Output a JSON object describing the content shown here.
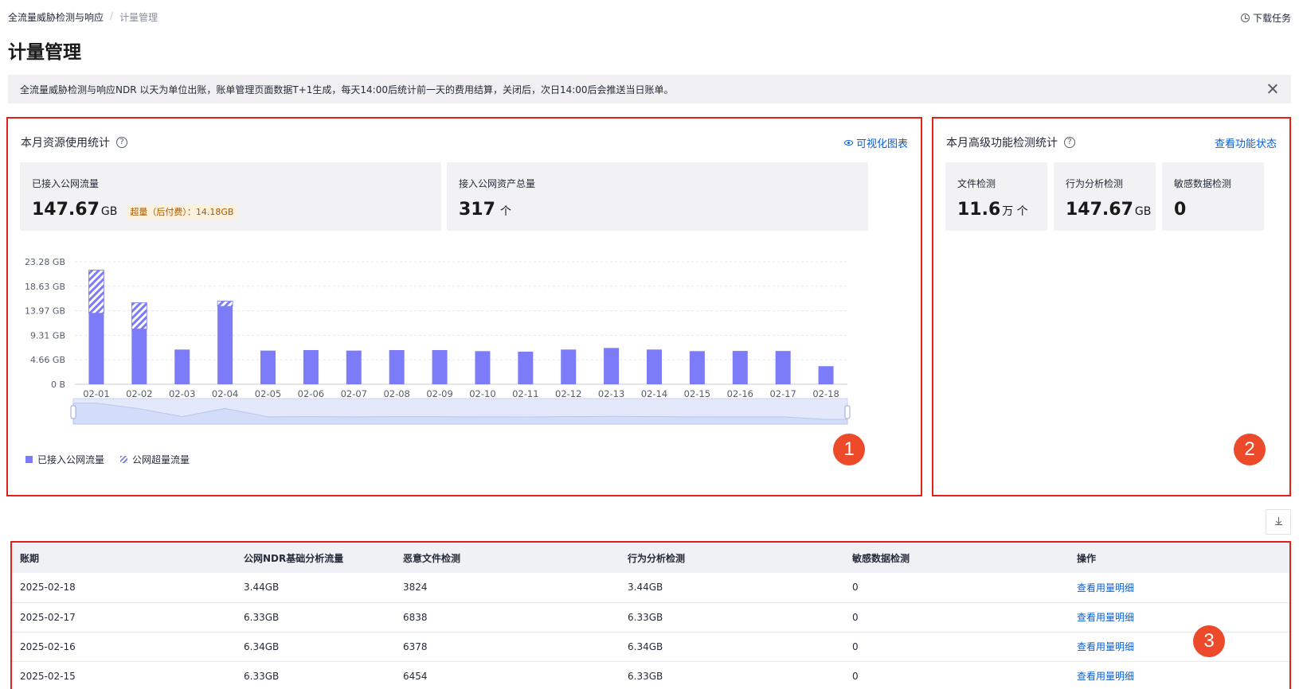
{
  "breadcrumb": {
    "parent": "全流量威胁检测与响应",
    "separator": "/",
    "current": "计量管理"
  },
  "header": {
    "download_tasks": "下载任务",
    "title": "计量管理"
  },
  "notice": {
    "text": "全流量威胁检测与响应NDR 以天为单位出账，账单管理页面数据T+1生成，每天14:00后统计前一天的费用结算，关闭后，次日14:00后会推送当日账单。"
  },
  "resource_panel": {
    "title": "本月资源使用统计",
    "visual_link": "可视化图表",
    "badge": "1",
    "cards": [
      {
        "label": "已接入公网流量",
        "value": "147.67",
        "unit": "GB",
        "overage": "超量（后付费）：14.18GB"
      },
      {
        "label": "接入公网资产总量",
        "value": "317",
        "unit": "个"
      }
    ]
  },
  "advanced_panel": {
    "title": "本月高级功能检测统计",
    "status_link": "查看功能状态",
    "badge": "2",
    "cards": [
      {
        "label": "文件检测",
        "value": "11.6",
        "unit": "万 个"
      },
      {
        "label": "行为分析检测",
        "value": "147.67",
        "unit": "GB"
      },
      {
        "label": "敏感数据检测",
        "value": "0",
        "unit": ""
      }
    ]
  },
  "chart_data": {
    "type": "bar",
    "stacked": true,
    "categories": [
      "02-01",
      "02-02",
      "02-03",
      "02-04",
      "02-05",
      "02-06",
      "02-07",
      "02-08",
      "02-09",
      "02-10",
      "02-11",
      "02-12",
      "02-13",
      "02-14",
      "02-15",
      "02-16",
      "02-17",
      "02-18"
    ],
    "series": [
      {
        "name": "已接入公网流量",
        "values": [
          13.5,
          10.5,
          6.6,
          14.8,
          6.4,
          6.5,
          6.4,
          6.5,
          6.5,
          6.3,
          6.2,
          6.6,
          6.9,
          6.6,
          6.3,
          6.34,
          6.33,
          3.44
        ]
      },
      {
        "name": "公网超量流量",
        "values": [
          8.2,
          5.0,
          0,
          1.0,
          0,
          0,
          0,
          0,
          0,
          0,
          0,
          0,
          0,
          0,
          0,
          0,
          0,
          0
        ]
      }
    ],
    "y_ticks": [
      "0 B",
      "4.66 GB",
      "9.31 GB",
      "13.97 GB",
      "18.63 GB",
      "23.28 GB"
    ],
    "ylim": [
      0,
      23.28
    ],
    "grid": "horizontal-dashed",
    "legend_position": "bottom-left",
    "colors": {
      "primary": "#7c7cf8"
    }
  },
  "table": {
    "badge": "3",
    "columns": [
      "账期",
      "公网NDR基础分析流量",
      "恶意文件检测",
      "行为分析检测",
      "敏感数据检测",
      "操作"
    ],
    "rows": [
      {
        "date": "2025-02-18",
        "ndr": "3.44GB",
        "malware": "3824",
        "behavior": "3.44GB",
        "sensitive": "0",
        "action": "查看用量明细"
      },
      {
        "date": "2025-02-17",
        "ndr": "6.33GB",
        "malware": "6838",
        "behavior": "6.33GB",
        "sensitive": "0",
        "action": "查看用量明细"
      },
      {
        "date": "2025-02-16",
        "ndr": "6.34GB",
        "malware": "6378",
        "behavior": "6.34GB",
        "sensitive": "0",
        "action": "查看用量明细"
      },
      {
        "date": "2025-02-15",
        "ndr": "6.33GB",
        "malware": "6454",
        "behavior": "6.33GB",
        "sensitive": "0",
        "action": "查看用量明细"
      }
    ]
  }
}
